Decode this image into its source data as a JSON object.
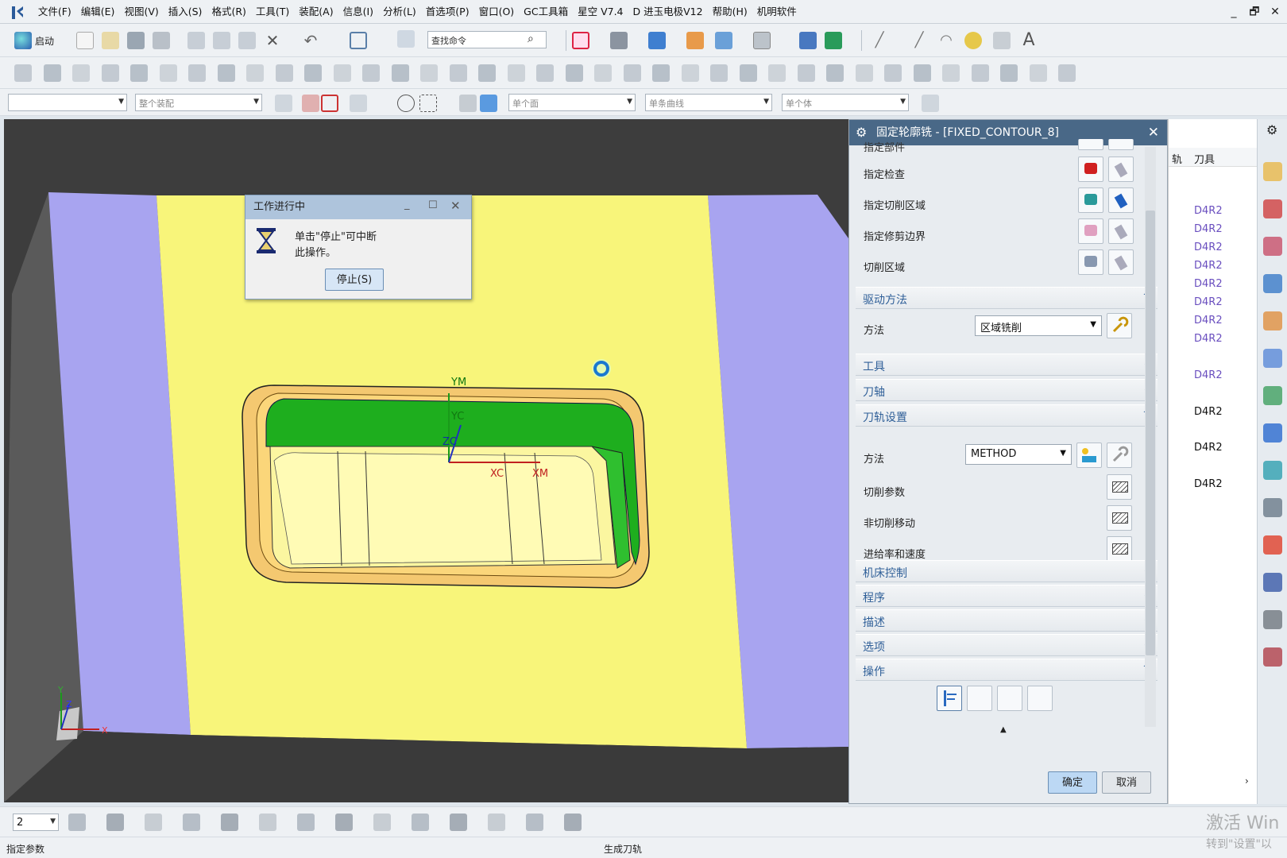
{
  "menubar": {
    "items": [
      "文件(F)",
      "编辑(E)",
      "视图(V)",
      "插入(S)",
      "格式(R)",
      "工具(T)",
      "装配(A)",
      "信息(I)",
      "分析(L)",
      "首选项(P)",
      "窗口(O)",
      "GC工具箱",
      "星空 V7.4",
      "D 进玉电极V12",
      "帮助(H)",
      "机明软件"
    ],
    "win_min": "_",
    "win_restore": "🗗",
    "win_close": "✕"
  },
  "toolbar1": {
    "start_label": "启动",
    "search_placeholder": "查找命令"
  },
  "toolbar3": {
    "combo_filter": "",
    "combo_assembly": "整个装配",
    "combo_face": "单个面",
    "combo_curve": "单条曲线",
    "combo_body": "单个体"
  },
  "viewport": {
    "labels": {
      "ym": "YM",
      "yc": "YC",
      "zc": "ZC",
      "xc": "XC",
      "xm": "XM",
      "wcs_y": "Y",
      "wcs_z": "Z",
      "wcs_x": "X"
    },
    "colors": {
      "background": "#3d3d3d",
      "face": "#f8f57a",
      "side": "#a8a4f0",
      "wall": "#1eae1e"
    }
  },
  "progress_dialog": {
    "title": "工作进行中",
    "message_line1": "单击\"停止\"可中断",
    "message_line2": "此操作。",
    "stop_button": "停止(S)"
  },
  "dialog": {
    "title": "固定轮廓铣 - [FIXED_CONTOUR_8]",
    "clipped_row": "指定部件",
    "rows": [
      "指定检查",
      "指定切削区域",
      "指定修剪边界",
      "切削区域"
    ],
    "drive_section": {
      "label": "驱动方法",
      "method_label": "方法",
      "method_value": "区域铣削"
    },
    "tool_section": "工具",
    "axis_section": "刀轴",
    "path_section": {
      "label": "刀轨设置",
      "method_label": "方法",
      "method_value": "METHOD",
      "rows": [
        "切削参数",
        "非切削移动",
        "进给率和速度"
      ]
    },
    "collapsed_sections": [
      "机床控制",
      "程序",
      "描述",
      "选项"
    ],
    "ops_section": "操作",
    "ok_button": "确定",
    "cancel_button": "取消"
  },
  "right_list": {
    "header_col1": "轨",
    "header_col2": "刀具",
    "tools": [
      "D4R2",
      "D4R2",
      "D4R2",
      "D4R2",
      "D4R2",
      "D4R2",
      "D4R2",
      "D4R2",
      "D4R2",
      "D4R2",
      "D4R2",
      "D4R2"
    ]
  },
  "bottombar": {
    "layer_value": "2"
  },
  "statusbar": {
    "left": "指定参数",
    "center": "生成刀轨"
  },
  "watermark": {
    "line1": "激活 Win",
    "line2": "转到\"设置\"以"
  }
}
